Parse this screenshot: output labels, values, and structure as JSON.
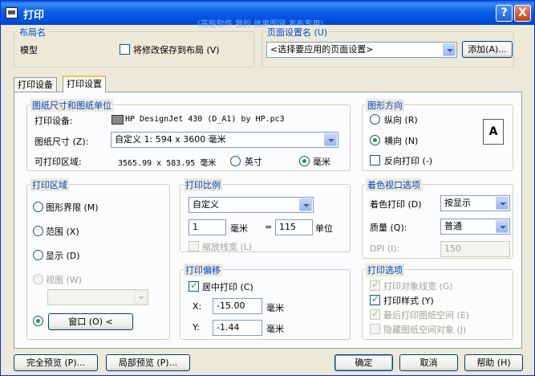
{
  "window": {
    "title": "打印",
    "watermark": "(高能软件 我的 效果图网 发布专用)",
    "help_label": "?",
    "close_label": "X"
  },
  "layout_name": {
    "label": "布局名",
    "value": "模型",
    "save_changes_label": "将修改保存到布局 (V)",
    "save_changes_checked": false
  },
  "page_setup": {
    "label": "页面设置名 (U)",
    "selected": "<选择要应用的页面设置>",
    "add_button": "添加(A)..."
  },
  "tabs": [
    {
      "label": "打印设备",
      "active": false
    },
    {
      "label": "打印设置",
      "active": true
    }
  ],
  "paper": {
    "group_label": "图纸尺寸和图纸单位",
    "device_label": "打印设备:",
    "device_value": "HP DesignJet 430 (D_A1) by HP.pc3",
    "size_label": "图纸尺寸 (Z):",
    "size_value": "自定义 1: 594 x 3600 毫米",
    "area_label": "可打印区域:",
    "area_value": "3565.99 x 583.95 毫米",
    "unit_inch": "英寸",
    "unit_mm": "毫米",
    "selected_unit": "mm"
  },
  "orientation": {
    "group_label": "图形方向",
    "portrait": "纵向 (R)",
    "landscape": "横向 (N)",
    "selected": "landscape",
    "reverse_label": "反向打印 (-)",
    "reverse_checked": false,
    "icon_letter": "A"
  },
  "plot_area": {
    "group_label": "打印区域",
    "options": [
      "图形界限 (M)",
      "范围 (X)",
      "显示 (D)",
      "视图 (W)",
      ""
    ],
    "selected_index": 4,
    "view_select_value": "",
    "window_button": "窗口 (O) <"
  },
  "scale": {
    "group_label": "打印比例",
    "selected": "自定义",
    "value_mm": "1",
    "mm_label": "毫米",
    "equals": "=",
    "value_units": "115",
    "units_label": "单位",
    "scale_lineweights": "缩放线宽 (L)",
    "scale_lineweights_checked": false
  },
  "offset": {
    "group_label": "打印偏移",
    "center_label": "居中打印 (C)",
    "center_checked": true,
    "x_label": "X:",
    "x_value": "-15.00",
    "y_label": "Y:",
    "y_value": "-1.44",
    "unit": "毫米"
  },
  "shaded_viewport": {
    "group_label": "着色视口选项",
    "shade_label": "着色打印 (D)",
    "shade_value": "按显示",
    "quality_label": "质量 (Q):",
    "quality_value": "普通",
    "dpi_label": "DPI (I):",
    "dpi_value": "150"
  },
  "plot_options": {
    "group_label": "打印选项",
    "items": [
      {
        "label": "打印对象线宽 (G)",
        "checked": true,
        "enabled": false
      },
      {
        "label": "打印样式 (Y)",
        "checked": true,
        "enabled": true
      },
      {
        "label": "最后打印图纸空间 (E)",
        "checked": true,
        "enabled": false
      },
      {
        "label": "隐藏图纸空间对象 (J)",
        "checked": false,
        "enabled": false
      }
    ]
  },
  "footer": {
    "full_preview": "完全预览 (P)...",
    "partial_preview": "局部预览 (P)...",
    "ok": "确定",
    "cancel": "取消",
    "help": "帮助 (H)"
  }
}
